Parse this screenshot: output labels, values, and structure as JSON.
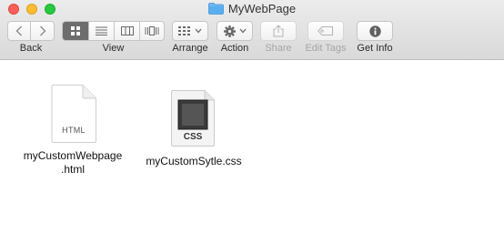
{
  "window": {
    "title": "MyWebPage"
  },
  "toolbar": {
    "back_label": "Back",
    "view_label": "View",
    "arrange_label": "Arrange",
    "action_label": "Action",
    "share_label": "Share",
    "edit_tags_label": "Edit Tags",
    "get_info_label": "Get Info"
  },
  "files": [
    {
      "name_line1": "myCustomWebpage",
      "name_line2": ".html",
      "icon_text": "HTML"
    },
    {
      "name_line1": "myCustomSytle.css",
      "icon_text": "CSS"
    }
  ],
  "colors": {
    "accent_selected": "#6d6d6d",
    "folder_blue": "#5aaef0"
  }
}
